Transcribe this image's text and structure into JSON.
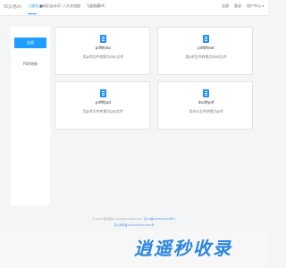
{
  "header": {
    "logo": "知云格AI",
    "nav": [
      {
        "label": "三键用"
      },
      {
        "label": "■知识去水印"
      },
      {
        "label": "八方文档图"
      },
      {
        "label": "飞速收藏HC"
      }
    ],
    "login": "注册",
    "register": "登录",
    "user_menu": "用户中心 ▾"
  },
  "sidebar": {
    "items": [
      {
        "label": "全部"
      },
      {
        "label": "PDF转换"
      }
    ]
  },
  "cards": [
    {
      "title": "pdf转doc",
      "desc": "用pdf文件转换为doc文件"
    },
    {
      "title": "pdf转text",
      "desc": "用pdf文件转换为text文件"
    },
    {
      "title": "pdf转ppt",
      "desc": "用pdf文件转换为ppt文件"
    },
    {
      "title": "doc转pdf",
      "desc": "用doc文件转换为pdf"
    }
  ],
  "footer": {
    "copyright": "© 2023 知云格AI. All Rights Reserved.",
    "icp": "京ICP备2023000000号-1",
    "police": "京公网安备11010502012345号"
  },
  "banner": {
    "text": "逍遥秒收录"
  },
  "colors": {
    "accent": "#1e9fff",
    "banner": "#2a86e0"
  }
}
